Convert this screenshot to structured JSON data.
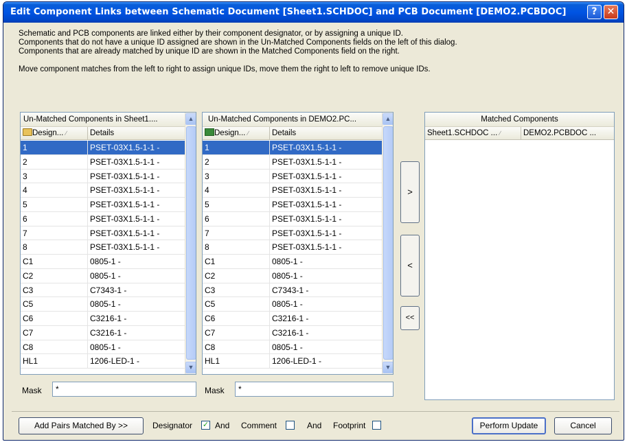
{
  "window": {
    "title": "Edit Component Links between Schematic Document [Sheet1.SCHDOC] and PCB Document [DEMO2.PCBDOC]",
    "help_label": "?",
    "close_label": "✕"
  },
  "description": {
    "line1": "Schematic and PCB components are linked either by their component designator, or by assigning a unique ID.",
    "line2": "Components that do not have a unique ID assigned are shown in the Un-Matched Components fields on the left of this dialog.",
    "line3": "Components that are already matched by unique ID are shown in the Matched Components field on the right.",
    "line4": "Move component matches from the left to right to assign unique IDs, move them the right to left to remove unique IDs."
  },
  "left_panel": {
    "title": "Un-Matched Components in Sheet1....",
    "col_designator": "Design...",
    "col_details": "Details",
    "rows": [
      {
        "designator": "1",
        "details": "PSET-03X1.5-1-1 -"
      },
      {
        "designator": "2",
        "details": "PSET-03X1.5-1-1 -"
      },
      {
        "designator": "3",
        "details": "PSET-03X1.5-1-1 -"
      },
      {
        "designator": "4",
        "details": "PSET-03X1.5-1-1 -"
      },
      {
        "designator": "5",
        "details": "PSET-03X1.5-1-1 -"
      },
      {
        "designator": "6",
        "details": "PSET-03X1.5-1-1 -"
      },
      {
        "designator": "7",
        "details": "PSET-03X1.5-1-1 -"
      },
      {
        "designator": "8",
        "details": "PSET-03X1.5-1-1 -"
      },
      {
        "designator": "C1",
        "details": "0805-1 -"
      },
      {
        "designator": "C2",
        "details": "0805-1 -"
      },
      {
        "designator": "C3",
        "details": "C7343-1 -"
      },
      {
        "designator": "C5",
        "details": "0805-1 -"
      },
      {
        "designator": "C6",
        "details": "C3216-1 -"
      },
      {
        "designator": "C7",
        "details": "C3216-1 -"
      },
      {
        "designator": "C8",
        "details": "0805-1 -"
      },
      {
        "designator": "HL1",
        "details": "1206-LED-1 -"
      }
    ],
    "mask_label": "Mask",
    "mask_value": "*"
  },
  "middle_panel": {
    "title": "Un-Matched Components in DEMO2.PC...",
    "col_designator": "Design...",
    "col_details": "Details",
    "rows": [
      {
        "designator": "1",
        "details": "PSET-03X1.5-1-1 -"
      },
      {
        "designator": "2",
        "details": "PSET-03X1.5-1-1 -"
      },
      {
        "designator": "3",
        "details": "PSET-03X1.5-1-1 -"
      },
      {
        "designator": "4",
        "details": "PSET-03X1.5-1-1 -"
      },
      {
        "designator": "5",
        "details": "PSET-03X1.5-1-1 -"
      },
      {
        "designator": "6",
        "details": "PSET-03X1.5-1-1 -"
      },
      {
        "designator": "7",
        "details": "PSET-03X1.5-1-1 -"
      },
      {
        "designator": "8",
        "details": "PSET-03X1.5-1-1 -"
      },
      {
        "designator": "C1",
        "details": "0805-1 -"
      },
      {
        "designator": "C2",
        "details": "0805-1 -"
      },
      {
        "designator": "C3",
        "details": "C7343-1 -"
      },
      {
        "designator": "C5",
        "details": "0805-1 -"
      },
      {
        "designator": "C6",
        "details": "C3216-1 -"
      },
      {
        "designator": "C7",
        "details": "C3216-1 -"
      },
      {
        "designator": "C8",
        "details": "0805-1 -"
      },
      {
        "designator": "HL1",
        "details": "1206-LED-1 -"
      }
    ],
    "mask_label": "Mask",
    "mask_value": "*"
  },
  "right_panel": {
    "title": "Matched Components",
    "col_sch": "Sheet1.SCHDOC ...",
    "col_pcb": "DEMO2.PCBDOC ..."
  },
  "move_buttons": {
    "right": ">",
    "left": "<",
    "all_left": "<<"
  },
  "bottom": {
    "add_pairs_label": "Add Pairs Matched By >>",
    "designator_label": "Designator",
    "designator_checked": true,
    "and1_label": "And",
    "comment_label": "Comment",
    "comment_checked": false,
    "and2_label": "And",
    "footprint_label": "Footprint",
    "footprint_checked": false,
    "perform_update_label": "Perform Update",
    "cancel_label": "Cancel"
  },
  "icons": {
    "sch_icon": "folder-icon",
    "pcb_icon": "pcb-icon",
    "sort": "sort-up-icon"
  },
  "colors": {
    "selected_row": "#316ac5",
    "title_bar": "#0054e3",
    "dialog_bg": "#ece9d8"
  },
  "selected_row_index": 0
}
